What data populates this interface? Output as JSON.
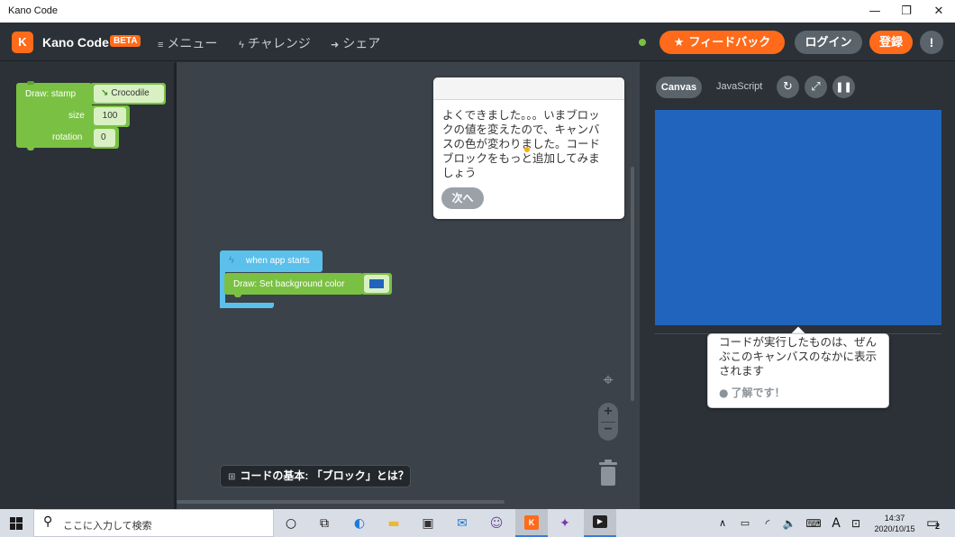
{
  "window": {
    "title": "Kano Code",
    "minimize": "—",
    "restore": "❐",
    "close": "✕"
  },
  "header": {
    "logo_letter": "K",
    "app_name": "Kano Code",
    "beta": "BETA",
    "nav": [
      {
        "icon": "menu-lines-icon",
        "label": "メニュー"
      },
      {
        "icon": "lightning-icon",
        "label": "チャレンジ"
      },
      {
        "icon": "share-arrow-icon",
        "label": "シェア"
      }
    ],
    "feedback": "フィードバック",
    "login": "ログイン",
    "signup": "登録",
    "alert": "!"
  },
  "toolbox": {
    "stamp_block": {
      "label": "Draw: stamp",
      "image_value": "Crocodile",
      "size_label": "size",
      "size_value": "100",
      "rotation_label": "rotation",
      "rotation_value": "0"
    }
  },
  "workspace": {
    "hint": {
      "text": "よくできました。。。いまブロックの値を変えたので、キャンバスの色が変わりました。コードブロックをもっと追加してみましょう",
      "next": "次へ"
    },
    "start_block": "when app starts",
    "bg_block": "Draw: Set background color",
    "bg_color": "#2064bd",
    "zoom_in": "+",
    "zoom_out": "−",
    "basics_chip": "コードの基本: 「ブロック」とは？"
  },
  "canvas_panel": {
    "tab_canvas": "Canvas",
    "tab_js": "JavaScript",
    "canvas_color": "#2064bd",
    "tip_text": "コードが実行したものは、ぜんぶこのキャンバスのなかに表示されます",
    "tip_ok": "了解です！"
  },
  "taskbar": {
    "search_placeholder": "ここに入力して検索",
    "time": "14:37",
    "date": "2020/10/15",
    "ime": "A",
    "notifications": "2"
  },
  "colors": {
    "accent": "#ff6b1a",
    "block_green": "#7ac143",
    "event_blue": "#5bc0eb"
  }
}
